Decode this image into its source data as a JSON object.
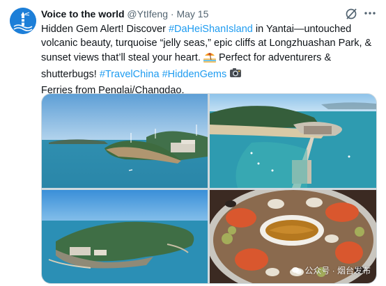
{
  "tweet": {
    "display_name": "Voice to the world",
    "handle": "@YtIfeng",
    "separator": "·",
    "date": "May 15",
    "text": {
      "line1_a": "Hidden Gem Alert! Discover ",
      "hashtag_1": "#DaHeiShanIsland",
      "line1_b": " in Yantai—untouched",
      "line2": "volcanic beauty, turquoise “jelly seas,” epic cliffs at Longzhuashan Park, &",
      "line3_a": "sunset views that’ll steal your heart. ",
      "line3_b": " Perfect for adventurers &",
      "line4_a": "shutterbugs! ",
      "hashtag_2": "#TravelChina",
      "hashtag_3": "#HiddenGems",
      "line5": "Ferries from Penglai/Changdao."
    },
    "emojis": [
      "beach-umbrella-icon",
      "camera-icon"
    ]
  },
  "media": {
    "images": [
      {
        "name": "island-coast-aerial-photo"
      },
      {
        "name": "pier-harbor-aerial-photo"
      },
      {
        "name": "island-top-aerial-photo"
      },
      {
        "name": "seafood-platter-photo"
      }
    ],
    "watermark": "公众号 · 烟台发布"
  },
  "colors": {
    "link": "#1d9bf0",
    "text": "#0f1419",
    "secondary": "#536471",
    "avatar_bg": "#1d7fd8"
  }
}
